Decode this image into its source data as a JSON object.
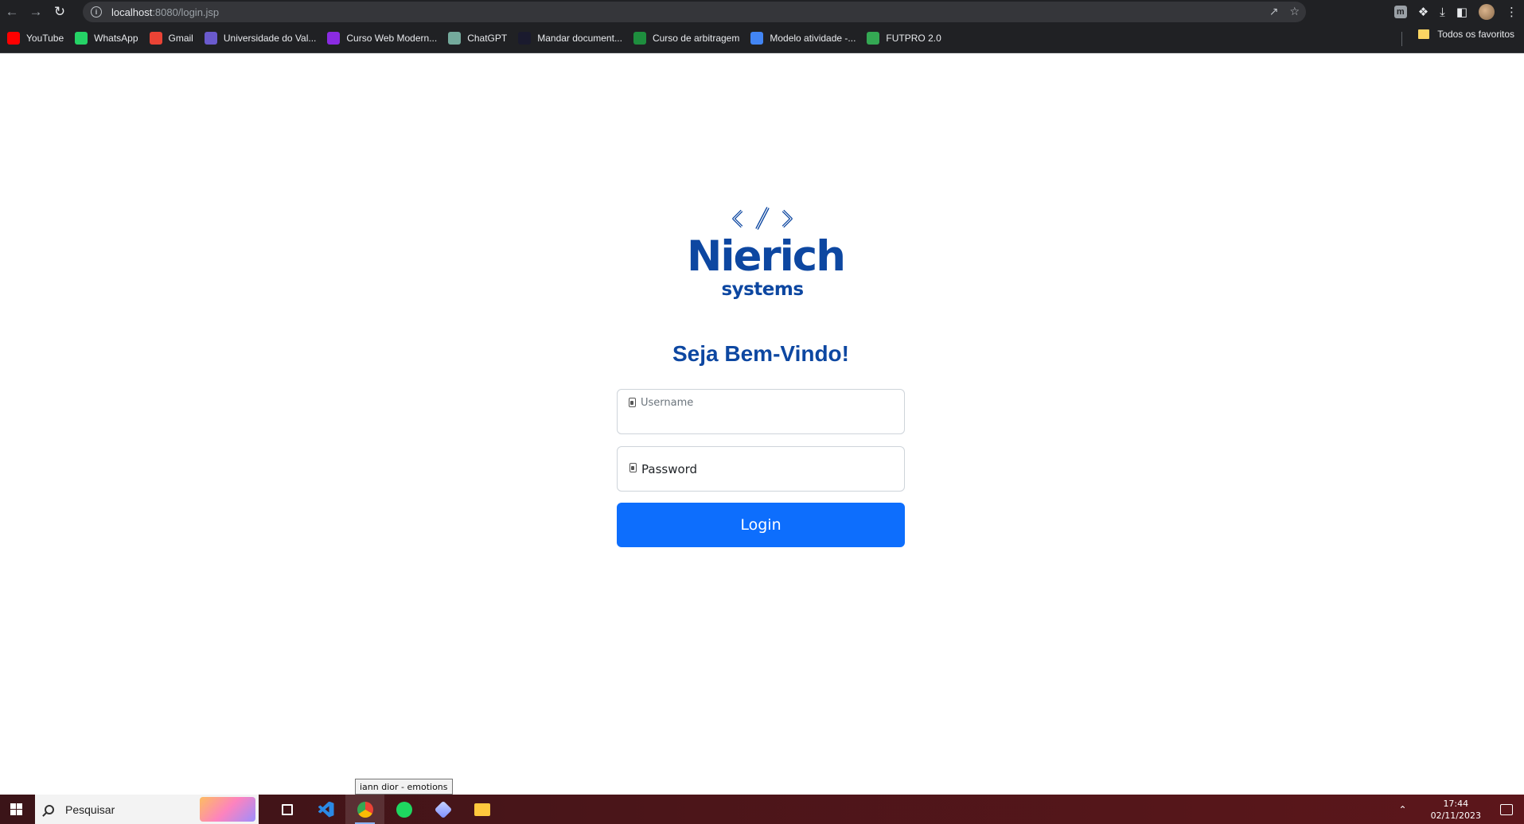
{
  "browser": {
    "url_host": "localhost",
    "url_rest": ":8080/login.jsp"
  },
  "bookmarks": [
    {
      "label": "YouTube",
      "icon": "youtube-icon",
      "color": "#ff0000"
    },
    {
      "label": "WhatsApp",
      "icon": "whatsapp-icon",
      "color": "#25d366"
    },
    {
      "label": "Gmail",
      "icon": "gmail-icon",
      "color": "#ea4335"
    },
    {
      "label": "Universidade do Val...",
      "icon": "university-icon",
      "color": "#6a5acd"
    },
    {
      "label": "Curso Web Modern...",
      "icon": "course-icon",
      "color": "#8a2be2"
    },
    {
      "label": "ChatGPT",
      "icon": "chatgpt-icon",
      "color": "#74aa9c"
    },
    {
      "label": "Mandar document...",
      "icon": "dio-icon",
      "color": "#1a1a2e"
    },
    {
      "label": "Curso de arbitragem",
      "icon": "classroom-icon",
      "color": "#1e8e3e"
    },
    {
      "label": "Modelo atividade -...",
      "icon": "docs-icon",
      "color": "#4285f4"
    },
    {
      "label": "FUTPRO 2.0",
      "icon": "futpro-icon",
      "color": "#34a853"
    }
  ],
  "bookmarks_right": {
    "label": "Todos os favoritos",
    "icon": "folder-icon"
  },
  "page": {
    "brand_name": "Nierich",
    "brand_sub": "systems",
    "brand_color": "#0d47a1",
    "welcome": "Seja Bem-Vindo!",
    "username_label": "Username",
    "password_label": "Password",
    "login_label": "Login",
    "accent": "#0d6efd"
  },
  "tooltip": "iann dior - emotions",
  "taskbar": {
    "search_placeholder": "Pesquisar",
    "apps": [
      "task-view-icon",
      "vscode-icon",
      "chrome-icon",
      "spotify-icon",
      "app-cube-icon",
      "file-explorer-icon"
    ],
    "time": "17:44",
    "date": "02/11/2023"
  }
}
